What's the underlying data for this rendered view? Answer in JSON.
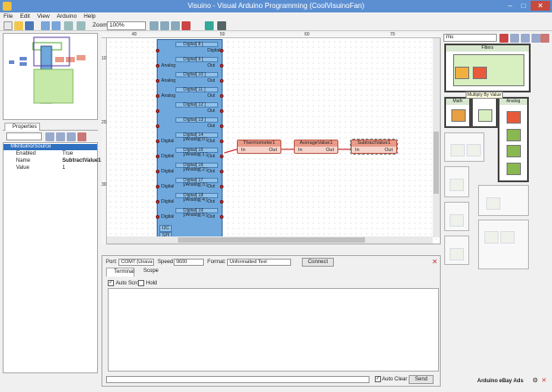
{
  "window": {
    "title": "Visuino - Visual Arduino Programming (CoolVisuinoFan)"
  },
  "menu": [
    "File",
    "Edit",
    "View",
    "Arduino",
    "Help"
  ],
  "toolbar": {
    "zoom_label": "Zoom:",
    "zoom_value": "100%"
  },
  "properties": {
    "tab_label": "Properties",
    "tree_root": "Mkrduino/Source",
    "rows": [
      {
        "key": "Enabled",
        "value": "True"
      },
      {
        "key": "Name",
        "value": "SubtractValue1"
      },
      {
        "key": "Value",
        "value": "1"
      }
    ]
  },
  "canvas": {
    "ruler_ticks": [
      "40",
      "50",
      "60",
      "70"
    ],
    "ruler_left_ticks": [
      "10",
      "20",
      "30"
    ],
    "arduino_pins": [
      {
        "header": "Digital[ 8 ]",
        "left": "",
        "right": "Digital"
      },
      {
        "header": "Digital[ 9 ]",
        "left": "Analog",
        "right": "Out"
      },
      {
        "header": "Digital[ 10 ]",
        "left": "Analog",
        "right": "Out"
      },
      {
        "header": "Digital[ 11 ]",
        "left": "Analog",
        "right": "Out"
      },
      {
        "header": "Digital[ 12 ]",
        "left": "",
        "right": "Out"
      },
      {
        "header": "Digital[ 13 ]",
        "left": "",
        "right": "Out"
      },
      {
        "header": "Digital[ 14 ]/Analog[ 0 ]",
        "left": "Digital",
        "right": "Out"
      },
      {
        "header": "Digital[ 15 ]/Analog[ 1 ]",
        "left": "Digital",
        "right": "Out"
      },
      {
        "header": "Digital[ 16 ]/Analog[ 2 ]",
        "left": "Digital",
        "right": "Out"
      },
      {
        "header": "Digital[ 17 ]/Analog[ 3 ]",
        "left": "Digital",
        "right": "Out"
      },
      {
        "header": "Digital[ 18 ]/Analog[ 4 ]",
        "left": "Digital",
        "right": "Out"
      },
      {
        "header": "Digital[ 19 ]/Analog[ 5 ]",
        "left": "Digital",
        "right": "Out"
      }
    ],
    "components": [
      {
        "name": "Thermometer1",
        "in": "In",
        "out": "Out"
      },
      {
        "name": "AverageValue1",
        "in": "In",
        "out": "Out"
      },
      {
        "name": "SubtractValue1",
        "in": "In",
        "out": "Out"
      }
    ],
    "board_footer": [
      "I2C",
      "SPI"
    ]
  },
  "serial": {
    "port_label": "Port:",
    "port_value": "COM7 (Unava",
    "speed_label": "Speed:",
    "speed_value": "9600",
    "format_label": "Format:",
    "format_value": "Unformatted Text",
    "connect_label": "Connect",
    "tabs": [
      "Terminal",
      "Scope"
    ],
    "auto_scroll": "Auto Scroll",
    "hold": "Hold",
    "auto_clear": "Auto Clear",
    "send": "Send"
  },
  "palette": {
    "search": "mu",
    "tooltip": "Multiply By Value",
    "group_filter": "Filters",
    "group_math": "Math",
    "group_analog": "Analog",
    "ad_label": "Arduino eBay Ads"
  }
}
